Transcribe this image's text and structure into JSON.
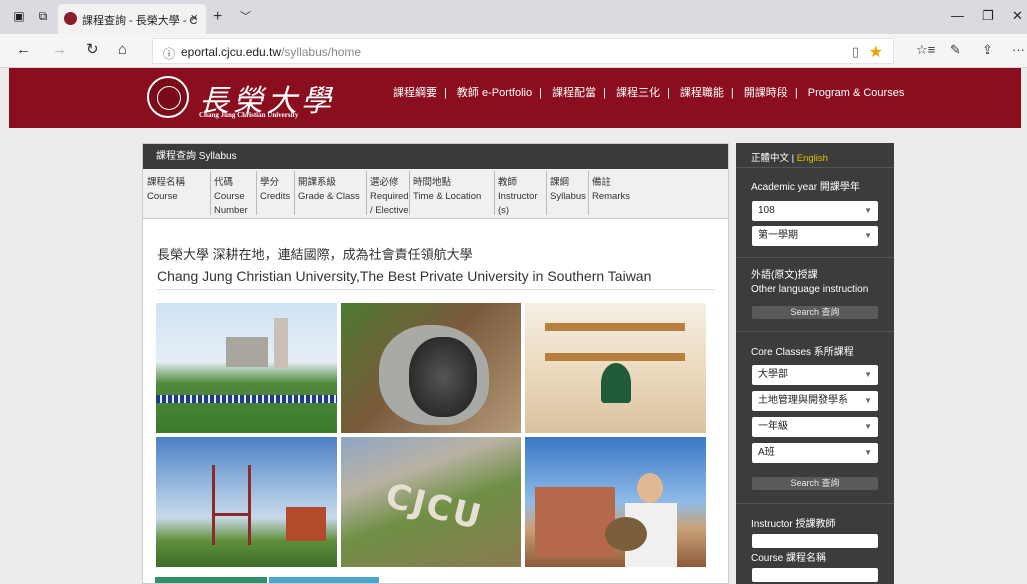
{
  "browser": {
    "tab_title": "課程查詢 - 長榮大學 - C",
    "url_host": "eportal.cjcu.edu.tw",
    "url_path": "/syllabus/home"
  },
  "header": {
    "logo_cn": "長榮大學",
    "logo_en": "Chang Jung Christian University",
    "nav": [
      "課程綱要",
      "教師 e-Portfolio",
      "課程配當",
      "課程三化",
      "課程職能",
      "開課時段",
      "Program & Courses"
    ]
  },
  "main": {
    "title": "課程查詢 Syllabus",
    "columns": [
      "課程名稱\nCourse",
      "代碼\nCourse\nNumber",
      "學分\nCredits",
      "開課系級\nGrade & Class",
      "選必修\nRequired\n/ Elective",
      "時間地點\nTime & Location",
      "教師\nInstructor\n(s)",
      "課綱\nSyllabus",
      "備註\nRemarks"
    ],
    "slogan_cn": "長榮大學 深耕在地，連結國際，成為社會責任領航大學",
    "slogan_en": "Chang Jung Christian University,The Best Private University in Southern Taiwan"
  },
  "sidebar": {
    "lang_zh": "正體中文",
    "lang_sep": "|",
    "lang_en": "English",
    "academic_year_label": "Academic year 開課學年",
    "year_value": "108",
    "semester_value": "第一學期",
    "other_lang_label_cn": "外語(原文)授課",
    "other_lang_label_en": "Other language instruction",
    "search_label": "Search 查詢",
    "core_label": "Core Classes 系所課程",
    "college_value": "大學部",
    "dept_value": "土地管理與開發學系",
    "grade_value": "一年級",
    "class_value": "A班",
    "instructor_label": "Instructor 授課教師",
    "course_label": "Course 課程名稱"
  },
  "colors": {
    "brand": "#8a0e1e",
    "sidebar_bg": "#3c3c3c",
    "lang_active": "#e3c000"
  }
}
